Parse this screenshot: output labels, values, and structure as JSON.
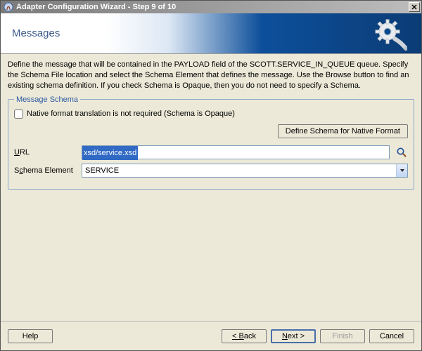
{
  "window": {
    "title": "Adapter Configuration Wizard - Step 9 of 10"
  },
  "banner": {
    "heading": "Messages"
  },
  "description": "Define the message that will be contained in the PAYLOAD field of the SCOTT.SERVICE_IN_QUEUE queue.  Specify the Schema File location and select the Schema Element that defines the message. Use the Browse button to find an existing schema definition. If you check Schema is Opaque, then you do not need to specify a Schema.",
  "schema": {
    "legend": "Message Schema",
    "opaque_checkbox_label": "Native format translation is not required (Schema is Opaque)",
    "opaque_checked": false,
    "define_button": "Define Schema for Native Format",
    "url_label": "URL",
    "url_value": "xsd/service.xsd",
    "element_label_pre": "S",
    "element_label_mid": "chema Element",
    "element_value": "SERVICE"
  },
  "footer": {
    "help": "Help",
    "back": "< Back",
    "next": "Next >",
    "finish": "Finish",
    "cancel": "Cancel"
  },
  "labels": {
    "url_u": "U",
    "url_rest": "RL"
  }
}
